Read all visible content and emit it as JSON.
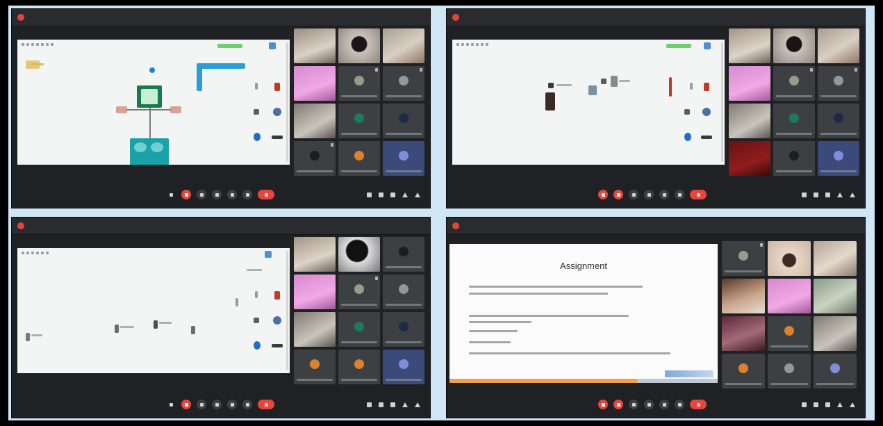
{
  "collage": {
    "screens": [
      {
        "id": "shot-1",
        "app_title": "",
        "meeting_info": "",
        "content": "circuit-simulator"
      },
      {
        "id": "shot-2",
        "app_title": "",
        "meeting_info": "",
        "content": "circuit-simulator"
      },
      {
        "id": "shot-3",
        "app_title": "",
        "meeting_info": "",
        "content": "circuit-simulator"
      },
      {
        "id": "shot-4",
        "app_title": "",
        "meeting_info": "",
        "content": "presentation-slide",
        "slide": {
          "title": "Assignment"
        }
      }
    ]
  },
  "icons": {
    "mic": "mic-icon",
    "camera": "camera-icon",
    "captions": "captions-icon",
    "raise_hand": "raise-hand-icon",
    "present": "present-icon",
    "more": "more-options-icon",
    "hang_up": "hang-up-icon",
    "info": "info-icon",
    "people": "people-icon",
    "chat": "chat-icon",
    "activities": "activities-icon"
  },
  "colors": {
    "frame_bg": "#cfe6f5",
    "meet_bg": "#202124",
    "tile_bg": "#3c4043",
    "control_red": "#e8453c",
    "accent_orange": "#f0a24a"
  }
}
